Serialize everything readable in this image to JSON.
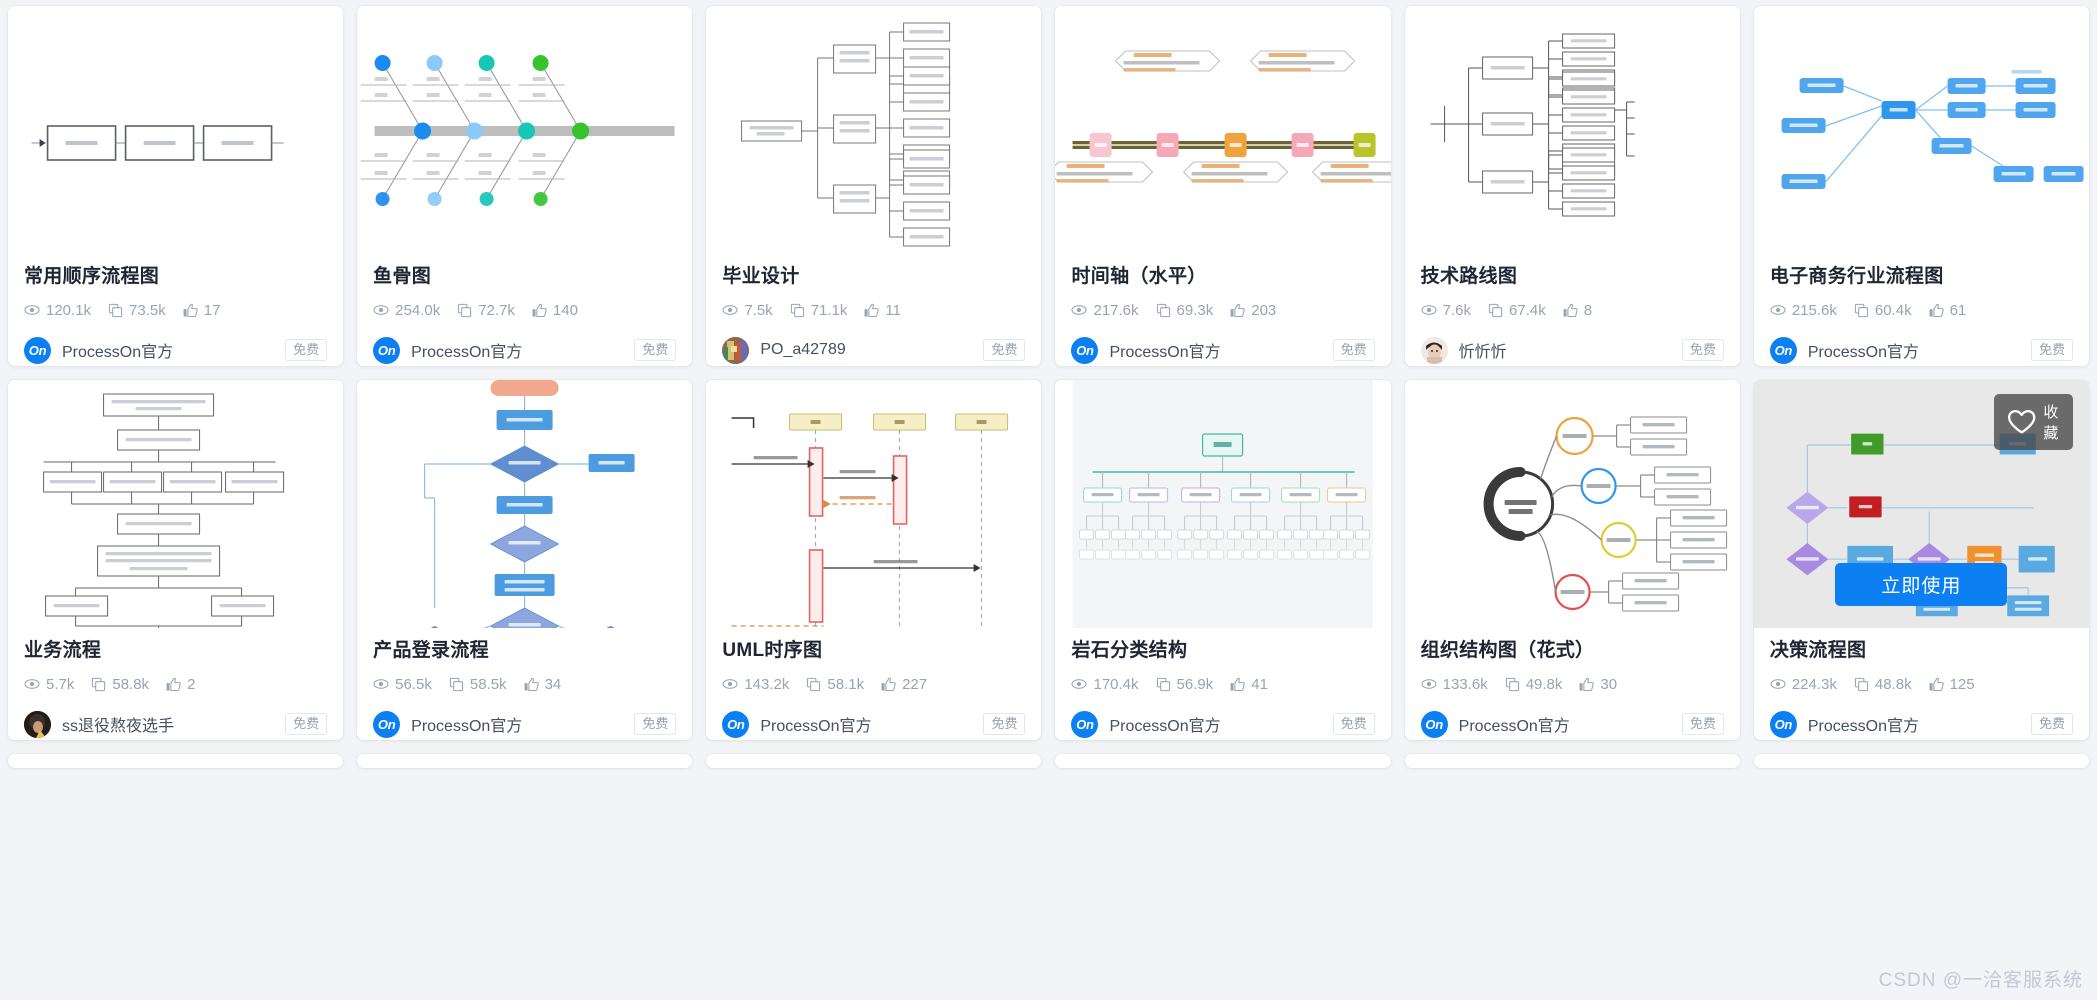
{
  "watermark": "CSDN @一洽客服系统",
  "icons": {
    "views": "eye-icon",
    "copies": "copy-icon",
    "likes": "thumbs-up-icon",
    "favorite": "heart-icon"
  },
  "overlay": {
    "favorite_label": "收藏",
    "use_label": "立即使用"
  },
  "free_label": "免费",
  "official_avatar_text": "On",
  "cards": [
    {
      "title": "常用顺序流程图",
      "views": "120.1k",
      "copies": "73.5k",
      "likes": "17",
      "author": "ProcessOn官方",
      "author_type": "official",
      "badge": "免费",
      "thumb": "sequence-flow",
      "hovered": false
    },
    {
      "title": "鱼骨图",
      "views": "254.0k",
      "copies": "72.7k",
      "likes": "140",
      "author": "ProcessOn官方",
      "author_type": "official",
      "badge": "免费",
      "thumb": "fishbone",
      "hovered": false
    },
    {
      "title": "毕业设计",
      "views": "7.5k",
      "copies": "71.1k",
      "likes": "11",
      "author": "PO_a42789",
      "author_type": "photo-orange",
      "badge": "免费",
      "thumb": "tree-mindmap",
      "hovered": false
    },
    {
      "title": "时间轴（水平）",
      "views": "217.6k",
      "copies": "69.3k",
      "likes": "203",
      "author": "ProcessOn官方",
      "author_type": "official",
      "badge": "免费",
      "thumb": "timeline",
      "hovered": false
    },
    {
      "title": "技术路线图",
      "views": "7.6k",
      "copies": "67.4k",
      "likes": "8",
      "author": "忻忻忻",
      "author_type": "photo-face",
      "badge": "免费",
      "thumb": "roadmap",
      "hovered": false
    },
    {
      "title": "电子商务行业流程图",
      "views": "215.6k",
      "copies": "60.4k",
      "likes": "61",
      "author": "ProcessOn官方",
      "author_type": "official",
      "badge": "免费",
      "thumb": "ecommerce",
      "hovered": false
    },
    {
      "title": "业务流程",
      "views": "5.7k",
      "copies": "58.8k",
      "likes": "2",
      "author": "ss退役熬夜选手",
      "author_type": "photo-dark",
      "badge": "免费",
      "thumb": "business-flow",
      "hovered": false
    },
    {
      "title": "产品登录流程",
      "views": "56.5k",
      "copies": "58.5k",
      "likes": "34",
      "author": "ProcessOn官方",
      "author_type": "official",
      "badge": "免费",
      "thumb": "login-flow",
      "hovered": false
    },
    {
      "title": "UML时序图",
      "views": "143.2k",
      "copies": "58.1k",
      "likes": "227",
      "author": "ProcessOn官方",
      "author_type": "official",
      "badge": "免费",
      "thumb": "uml-sequence",
      "hovered": false
    },
    {
      "title": "岩石分类结构",
      "views": "170.4k",
      "copies": "56.9k",
      "likes": "41",
      "author": "ProcessOn官方",
      "author_type": "official",
      "badge": "免费",
      "thumb": "rock-tree",
      "hovered": false
    },
    {
      "title": "组织结构图（花式）",
      "views": "133.6k",
      "copies": "49.8k",
      "likes": "30",
      "author": "ProcessOn官方",
      "author_type": "official",
      "badge": "免费",
      "thumb": "org-chart",
      "hovered": false
    },
    {
      "title": "决策流程图",
      "views": "224.3k",
      "copies": "48.8k",
      "likes": "125",
      "author": "ProcessOn官方",
      "author_type": "official",
      "badge": "免费",
      "thumb": "decision-flow",
      "hovered": true
    }
  ],
  "colors": {
    "accent": "#0c7ff2",
    "page_bg": "#f2f4f7",
    "card_bg": "#ffffff",
    "title": "#1f2533",
    "muted": "#9aa3b2"
  }
}
